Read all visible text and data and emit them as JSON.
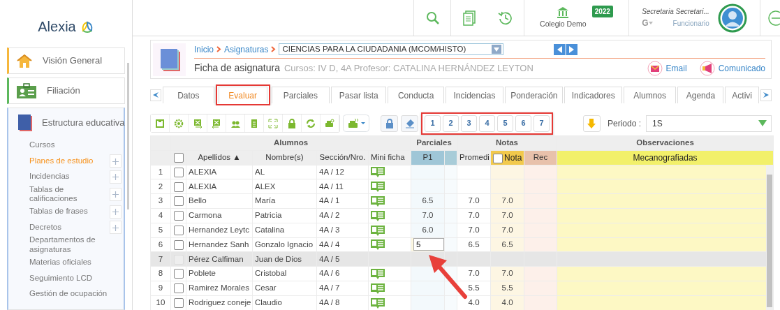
{
  "logo": {
    "text": "Alexia"
  },
  "sidebar": {
    "sections": [
      {
        "label": "Visión General",
        "kind": "home",
        "expanded": false
      },
      {
        "label": "Filiación",
        "kind": "card",
        "expanded": false
      },
      {
        "label": "Estructura educativa",
        "kind": "book",
        "expanded": true,
        "children": [
          {
            "label": "Cursos",
            "selected": false,
            "expandable": false
          },
          {
            "label": "Planes de estudio",
            "selected": true,
            "expandable": true
          },
          {
            "label": "Incidencias",
            "selected": false,
            "expandable": true
          },
          {
            "label": "Tablas de calificaciones",
            "selected": false,
            "expandable": true
          },
          {
            "label": "Tablas de frases",
            "selected": false,
            "expandable": true
          },
          {
            "label": "Decretos",
            "selected": false,
            "expandable": true
          },
          {
            "label": "Departamentos de asignaturas",
            "selected": false,
            "expandable": false
          },
          {
            "label": "Materias oficiales",
            "selected": false,
            "expandable": false
          },
          {
            "label": "Seguimiento LCD",
            "selected": false,
            "expandable": false
          },
          {
            "label": "Gestión de ocupación",
            "selected": false,
            "expandable": false
          }
        ]
      }
    ]
  },
  "header": {
    "school": {
      "name": "Colegio Demo",
      "year": "2022"
    },
    "user": {
      "name": "Secretaria Secretari...",
      "role": "Funcionario",
      "switcher": "G"
    }
  },
  "subject": {
    "breadcrumb": [
      "Inicio",
      "Asignaturas"
    ],
    "select": "CIENCIAS PARA LA CIUDADANIA (MCOM/HISTO)",
    "title": "Ficha de asignatura",
    "details": "Cursos: IV D, 4A Profesor: CATALINA HERNÁNDEZ LEYTON",
    "links": [
      {
        "label": "Email",
        "kind": "email"
      },
      {
        "label": "Comunicado",
        "kind": "announce"
      }
    ]
  },
  "tabs": [
    {
      "label": "Datos",
      "selected": false,
      "highlighted": false
    },
    {
      "label": "Evaluar",
      "selected": true,
      "highlighted": true
    },
    {
      "label": "Parciales",
      "selected": false,
      "highlighted": false
    },
    {
      "label": "Pasar lista",
      "selected": false,
      "highlighted": false
    },
    {
      "label": "Conducta",
      "selected": false,
      "highlighted": false
    },
    {
      "label": "Incidencias",
      "selected": false,
      "highlighted": false
    },
    {
      "label": "Ponderación",
      "selected": false,
      "highlighted": false
    },
    {
      "label": "Indicadores",
      "selected": false,
      "highlighted": false
    },
    {
      "label": "Alumnos",
      "selected": false,
      "highlighted": false
    },
    {
      "label": "Agenda",
      "selected": false,
      "highlighted": false
    },
    {
      "label": "Activi",
      "selected": false,
      "highlighted": false
    }
  ],
  "toolbar": {
    "numbers": [
      "1",
      "2",
      "3",
      "4",
      "5",
      "6",
      "7"
    ],
    "numbers_highlighted": true,
    "period": {
      "label": "Periodo :",
      "value": "1S"
    }
  },
  "table": {
    "groups": [
      "Alumnos",
      "Parciales",
      "Notas",
      "Observaciones"
    ],
    "columns": {
      "surname": "Apellidos ▲",
      "name": "Nombre(s)",
      "section": "Sección/Nro.",
      "mini": "Mini ficha",
      "p1": "P1",
      "average": "Promedi",
      "grade": "Nota",
      "rec": "Rec",
      "obs": "Mecanografiadas"
    },
    "grade_checked": false,
    "select_all_checked": false,
    "arrow_annotation": true,
    "rows": [
      {
        "number": "1",
        "surname": "ALEXIA",
        "name": "AL",
        "section": "4A / 12",
        "checked": false,
        "disabled": false,
        "mini_ficha": true,
        "p1": "",
        "editing": false,
        "average": "",
        "grade": ""
      },
      {
        "number": "2",
        "surname": "ALEXIA",
        "name": "ALEX",
        "section": "4A / 11",
        "checked": false,
        "disabled": false,
        "mini_ficha": true,
        "p1": "",
        "editing": false,
        "average": "",
        "grade": ""
      },
      {
        "number": "3",
        "surname": "Bello",
        "name": "María",
        "section": "4A /  1",
        "checked": false,
        "disabled": false,
        "mini_ficha": true,
        "p1": "6.5",
        "editing": false,
        "average": "7.0",
        "grade": "7.0"
      },
      {
        "number": "4",
        "surname": "Carmona",
        "name": "Patricia",
        "section": "4A /  2",
        "checked": false,
        "disabled": false,
        "mini_ficha": true,
        "p1": "7.0",
        "editing": false,
        "average": "7.0",
        "grade": "7.0"
      },
      {
        "number": "5",
        "surname": "Hernandez Leytc",
        "name": "Catalina",
        "section": "4A /  3",
        "checked": false,
        "disabled": false,
        "mini_ficha": true,
        "p1": "6.0",
        "editing": false,
        "average": "7.0",
        "grade": "7.0"
      },
      {
        "number": "6",
        "surname": "Hernandez Sanh",
        "name": "Gonzalo Ignacio",
        "section": "4A /  4",
        "checked": false,
        "disabled": false,
        "mini_ficha": true,
        "p1": "5",
        "editing": true,
        "average": "6.5",
        "grade": "6.5"
      },
      {
        "number": "7",
        "surname": "Pérez Calfiman",
        "name": "Juan de Dios",
        "section": "4A /  5",
        "checked": false,
        "disabled": true,
        "mini_ficha": false,
        "p1": "",
        "editing": false,
        "average": "",
        "grade": ""
      },
      {
        "number": "8",
        "surname": "Poblete",
        "name": "Cristobal",
        "section": "4A /  6",
        "checked": false,
        "disabled": false,
        "mini_ficha": true,
        "p1": "",
        "editing": false,
        "average": "7.0",
        "grade": "7.0"
      },
      {
        "number": "9",
        "surname": "Ramirez Morales",
        "name": "Cesar",
        "section": "4A /  7",
        "checked": false,
        "disabled": false,
        "mini_ficha": true,
        "p1": "",
        "editing": false,
        "average": "5.5",
        "grade": "5.5"
      },
      {
        "number": "10",
        "surname": "Rodriguez coneje",
        "name": "Claudio",
        "section": "4A /  8",
        "checked": false,
        "disabled": false,
        "mini_ficha": true,
        "p1": "",
        "editing": false,
        "average": "4.0",
        "grade": "4.0"
      }
    ]
  }
}
